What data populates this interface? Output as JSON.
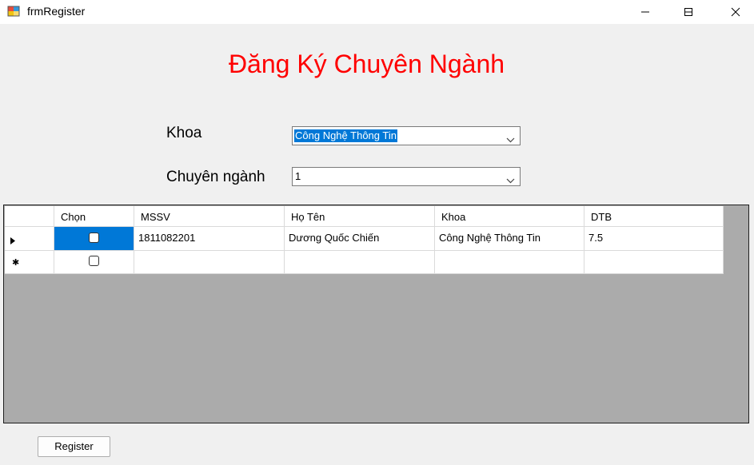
{
  "window": {
    "title": "frmRegister"
  },
  "heading": "Đăng Ký Chuyên Ngành",
  "form": {
    "khoa_label": "Khoa",
    "khoa_value": "Công Nghệ Thông Tin",
    "chuyennganh_label": "Chuyên ngành",
    "chuyennganh_value": "1"
  },
  "table": {
    "columns": [
      "Chọn",
      "MSSV",
      "Họ Tên",
      "Khoa",
      "DTB"
    ],
    "rows": [
      {
        "chon": false,
        "mssv": "1811082201",
        "hoten": "Dương Quốc Chiến",
        "khoa": "Công Nghệ Thông Tin",
        "dtb": "7.5"
      }
    ]
  },
  "buttons": {
    "register": "Register"
  },
  "colors": {
    "heading": "#ff0000",
    "selection": "#0078d7",
    "grid_background": "#ababab"
  }
}
